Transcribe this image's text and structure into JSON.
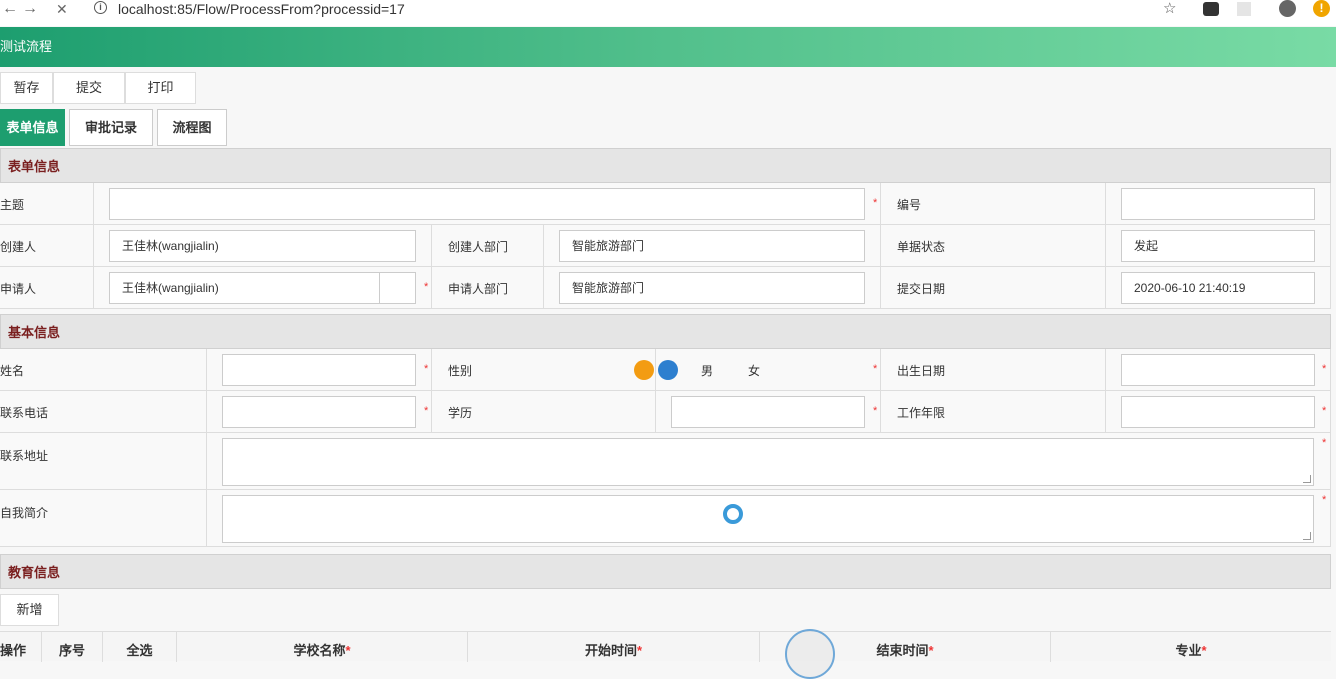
{
  "browser": {
    "url": "localhost:85/Flow/ProcessFrom?processid=17",
    "back_glyph": "←",
    "forward_glyph": "→",
    "stop_glyph": "✕",
    "info_glyph": "i",
    "star_glyph": "☆",
    "warn_glyph": "!"
  },
  "app": {
    "title": "测试流程",
    "accent": "#1d9e6f"
  },
  "toolbar": {
    "save_draft": "暂存",
    "submit": "提交",
    "print": "打印"
  },
  "tabs": [
    {
      "label": "表单信息",
      "active": true
    },
    {
      "label": "审批记录",
      "active": false
    },
    {
      "label": "流程图",
      "active": false
    }
  ],
  "form_info": {
    "header": "表单信息",
    "subject_label": "主题",
    "subject_value": "",
    "number_label": "编号",
    "number_value": "",
    "creator_label": "创建人",
    "creator_value": "王佳林(wangjialin)",
    "creator_dept_label": "创建人部门",
    "creator_dept_value": "智能旅游部门",
    "doc_status_label": "单据状态",
    "doc_status_value": "发起",
    "applicant_label": "申请人",
    "applicant_value": "王佳林(wangjialin)",
    "applicant_dept_label": "申请人部门",
    "applicant_dept_value": "智能旅游部门",
    "submit_date_label": "提交日期",
    "submit_date_value": "2020-06-10 21:40:19"
  },
  "basic_info": {
    "header": "基本信息",
    "name_label": "姓名",
    "gender_label": "性别",
    "gender_male": "男",
    "gender_female": "女",
    "birth_label": "出生日期",
    "phone_label": "联系电话",
    "education_label": "学历",
    "work_years_label": "工作年限",
    "address_label": "联系地址",
    "intro_label": "自我简介"
  },
  "education_info": {
    "header": "教育信息",
    "add_label": "新增",
    "columns": [
      "操作",
      "序号",
      "全选",
      "学校名称",
      "开始时间",
      "结束时间",
      "专业"
    ]
  },
  "required_mark": "*",
  "colors": {
    "orange_dot": "#f39c12",
    "blue_dot": "#2d7fcf",
    "label_red": "#7a1f1f"
  }
}
